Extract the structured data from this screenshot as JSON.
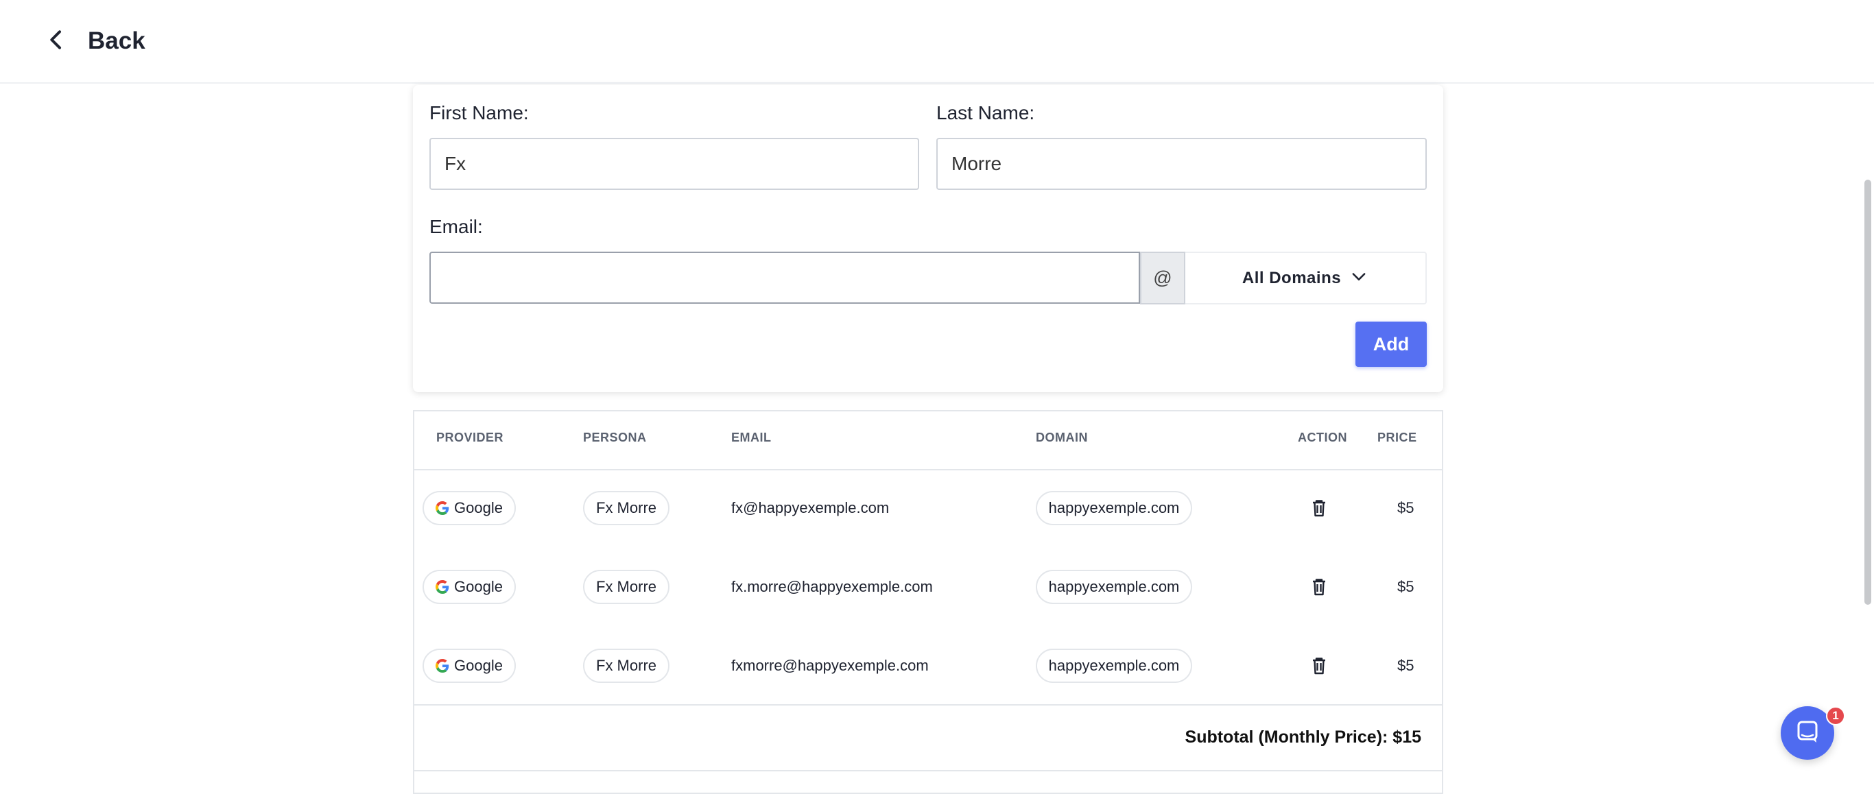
{
  "header": {
    "back_label": "Back"
  },
  "form": {
    "first_name_label": "First Name:",
    "first_name_value": "Fx",
    "last_name_label": "Last Name:",
    "last_name_value": "Morre",
    "email_label": "Email:",
    "email_value": "",
    "at_symbol": "@",
    "domain_select": "All Domains",
    "add_label": "Add"
  },
  "table": {
    "columns": [
      "PROVIDER",
      "PERSONA",
      "EMAIL",
      "DOMAIN",
      "ACTION",
      "PRICE"
    ],
    "rows": [
      {
        "provider": "Google",
        "persona": "Fx Morre",
        "email": "fx@happyexemple.com",
        "domain": "happyexemple.com",
        "price": "$5"
      },
      {
        "provider": "Google",
        "persona": "Fx Morre",
        "email": "fx.morre@happyexemple.com",
        "domain": "happyexemple.com",
        "price": "$5"
      },
      {
        "provider": "Google",
        "persona": "Fx Morre",
        "email": "fxmorre@happyexemple.com",
        "domain": "happyexemple.com",
        "price": "$5"
      }
    ],
    "subtotal": "Subtotal (Monthly Price): $15"
  },
  "chat": {
    "badge": "1"
  },
  "colors": {
    "accent": "#5670f2",
    "badge": "#e5484d"
  }
}
